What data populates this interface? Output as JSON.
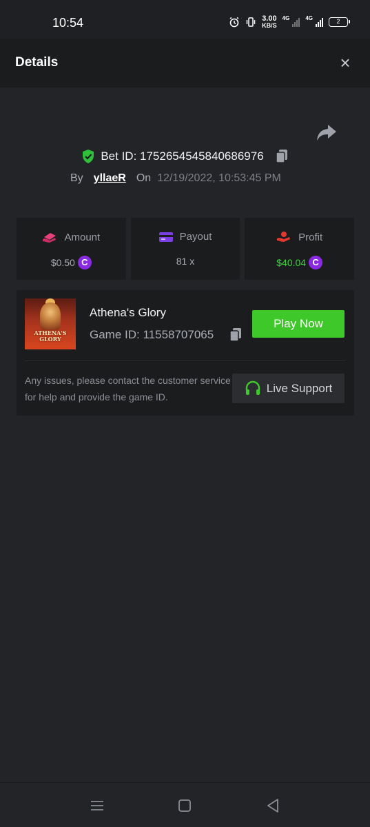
{
  "status_bar": {
    "time": "10:54",
    "net_speed_value": "3.00",
    "net_speed_unit": "KB/S",
    "network_1": "4G",
    "network_2": "4G",
    "battery_level": "2",
    "icons": [
      "alarm-icon",
      "vibrate-icon",
      "signal-icon",
      "battery-icon"
    ]
  },
  "header": {
    "title": "Details",
    "close_icon": "×"
  },
  "bet": {
    "id_label": "Bet ID: 1752654545840686976",
    "by_label": "By",
    "username": "yllaeR",
    "on_label": "On",
    "date": "12/19/2022, 10:53:45 PM"
  },
  "stats": {
    "amount": {
      "label": "Amount",
      "value": "$0.50",
      "icon": "money-hand-icon",
      "color": "#e8407a"
    },
    "payout": {
      "label": "Payout",
      "value": "81 x",
      "icon": "card-icon",
      "color": "#7b3fe4"
    },
    "profit": {
      "label": "Profit",
      "value": "$40.04",
      "icon": "coins-hand-icon",
      "color": "#e0392f"
    },
    "coin_symbol": "C"
  },
  "game": {
    "title": "Athena's Glory",
    "id_label": "Game ID: 11558707065",
    "thumb_text_line1": "ATHENA'S",
    "thumb_text_line2": "GLORY",
    "play_label": "Play Now",
    "issue_text": "Any issues, please contact the customer service for help and provide the game ID.",
    "support_label": "Live Support"
  },
  "colors": {
    "accent_green": "#3fc829",
    "profit_green": "#3fd33f",
    "coin_purple": "#8a2be2"
  }
}
